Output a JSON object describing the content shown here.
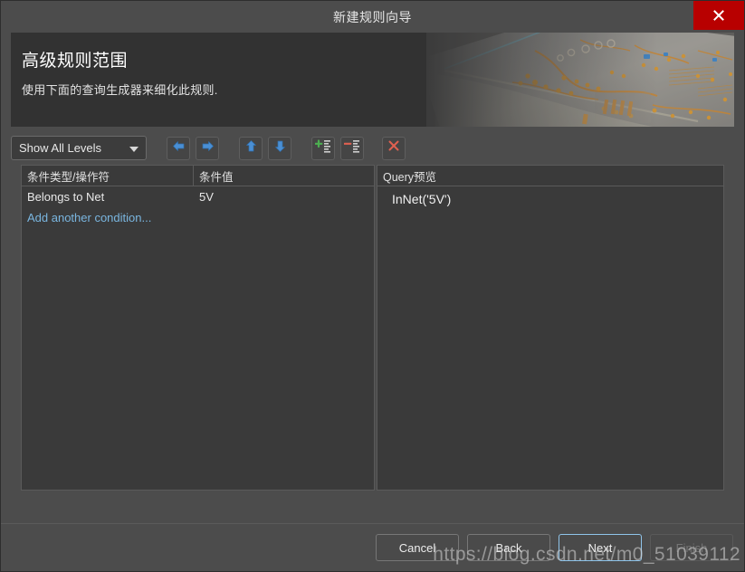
{
  "window": {
    "title": "新建规则向导",
    "close_icon": "close-icon"
  },
  "banner": {
    "title": "高级规则范围",
    "subtitle": "使用下面的查询生成器来细化此规则.",
    "artwork": "pcb-circuit-board-photo"
  },
  "toolbar": {
    "level_filter": {
      "value": "Show All Levels",
      "caret_icon": "chevron-down-icon"
    },
    "buttons": [
      {
        "name": "move-left-button",
        "icon": "arrow-left-icon",
        "color": "#4a8fd4"
      },
      {
        "name": "move-right-button",
        "icon": "arrow-right-icon",
        "color": "#4a8fd4"
      },
      {
        "name": "move-up-button",
        "icon": "arrow-up-icon",
        "color": "#4a8fd4"
      },
      {
        "name": "move-down-button",
        "icon": "arrow-down-icon",
        "color": "#4a8fd4"
      },
      {
        "name": "add-condition-button",
        "icon": "add-row-icon",
        "color": "#4caf50"
      },
      {
        "name": "remove-condition-button",
        "icon": "remove-row-icon",
        "color": "#e06050"
      },
      {
        "name": "delete-all-button",
        "icon": "delete-x-icon",
        "color": "#e06050"
      }
    ]
  },
  "conditions_table": {
    "columns": [
      "条件类型/操作符",
      "条件值"
    ],
    "rows": [
      {
        "type": "Belongs to Net",
        "value": "5V"
      }
    ],
    "add_link": "Add another condition..."
  },
  "query_panel": {
    "header": "Query预览",
    "text": "InNet('5V')"
  },
  "footer": {
    "buttons": [
      {
        "name": "cancel-button",
        "label": "Cancel",
        "state": "normal"
      },
      {
        "name": "back-button",
        "label": "Back",
        "state": "normal",
        "mnemonic": "B"
      },
      {
        "name": "next-button",
        "label": "Next",
        "state": "focused",
        "mnemonic": "N"
      },
      {
        "name": "finish-button",
        "label": "Finish",
        "state": "disabled",
        "mnemonic": "F"
      }
    ]
  },
  "watermark": {
    "text": "https://blog.csdn.net/m0_51039112"
  },
  "colors": {
    "window_bg": "#4c4c4c",
    "panel_bg": "#3a3a3a",
    "banner_bg": "#323232",
    "close_red": "#b80000",
    "link_blue": "#7ab6e0",
    "focus_blue": "#8fc4ea",
    "accent_green": "#4caf50",
    "accent_red": "#e06050",
    "arrow_blue": "#4a8fd4"
  }
}
